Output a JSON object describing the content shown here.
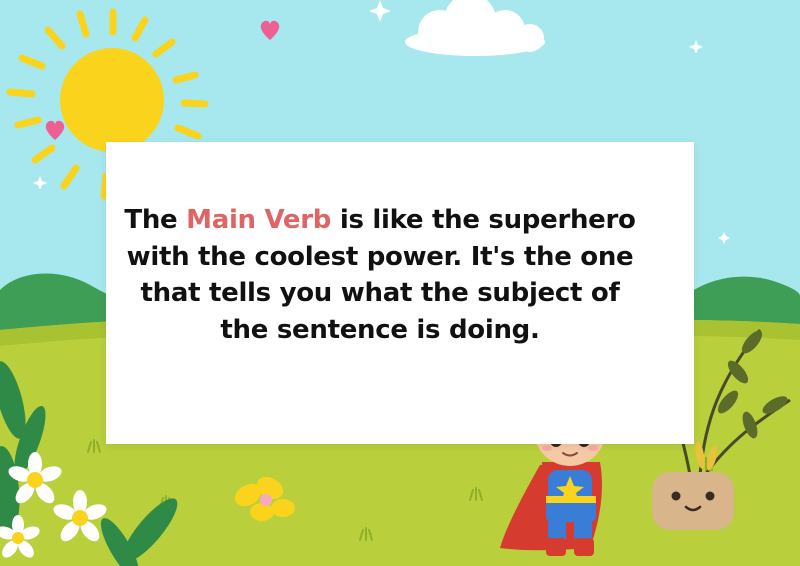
{
  "slide": {
    "text_before": "The ",
    "highlight": "Main Verb",
    "text_after": " is like the superhero with the coolest power. It's the one that tells you what the subject of the sentence is doing."
  },
  "colors": {
    "sky": "#a6e8ee",
    "grass": "#b9cf3c",
    "hill": "#3f9e55",
    "sun": "#fad41c",
    "highlight": "#e06463",
    "text": "#111111",
    "card": "#ffffff"
  },
  "illustrations": {
    "sun": "sun-icon",
    "cloud": "cloud-icon",
    "hearts": "heart-icon",
    "sparkles": "sparkle-icon",
    "flowers": "daisy-flower-icon",
    "plant": "potted-plant-icon",
    "character": "superhero-kid-icon"
  }
}
